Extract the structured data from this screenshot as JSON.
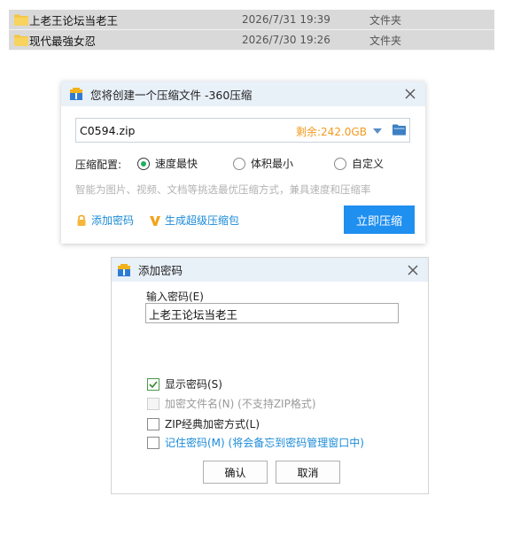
{
  "files": [
    {
      "name": "上老王论坛当老王",
      "date": "2026/7/31 19:39",
      "type": "文件夹"
    },
    {
      "name": "现代最強女忍",
      "date": "2026/7/30 19:26",
      "type": "文件夹"
    }
  ],
  "compress_dialog": {
    "title": "您将创建一个压缩文件 -360压缩",
    "filename": "C0594.zip",
    "space_left": "剩余:242.0GB",
    "config_label": "压缩配置:",
    "options": [
      {
        "label": "速度最快",
        "selected": true
      },
      {
        "label": "体积最小",
        "selected": false
      },
      {
        "label": "自定义",
        "selected": false
      }
    ],
    "hint": "智能为图片、视频、文档等挑选最优压缩方式，兼具速度和压缩率",
    "add_password": "添加密码",
    "super_pack": "生成超级压缩包",
    "compress_button": "立即压缩"
  },
  "password_dialog": {
    "title": "添加密码",
    "input_label": "输入密码(E)",
    "password_value": "上老王论坛当老王",
    "checkboxes": [
      {
        "label": "显示密码(S)",
        "checked": true,
        "enabled": true
      },
      {
        "label": "加密文件名(N) (不支持ZIP格式)",
        "checked": false,
        "enabled": false
      },
      {
        "label": "ZIP经典加密方式(L)",
        "checked": false,
        "enabled": true
      },
      {
        "label": "记住密码(M) (将会备忘到密码管理窗口中)",
        "checked": false,
        "enabled": true
      }
    ],
    "ok_button": "确认",
    "cancel_button": "取消"
  },
  "colors": {
    "accent_blue": "#1f8ff0",
    "link_blue": "#1a8bd8",
    "space_orange": "#f29a1f",
    "radio_green": "#1fae5f"
  }
}
